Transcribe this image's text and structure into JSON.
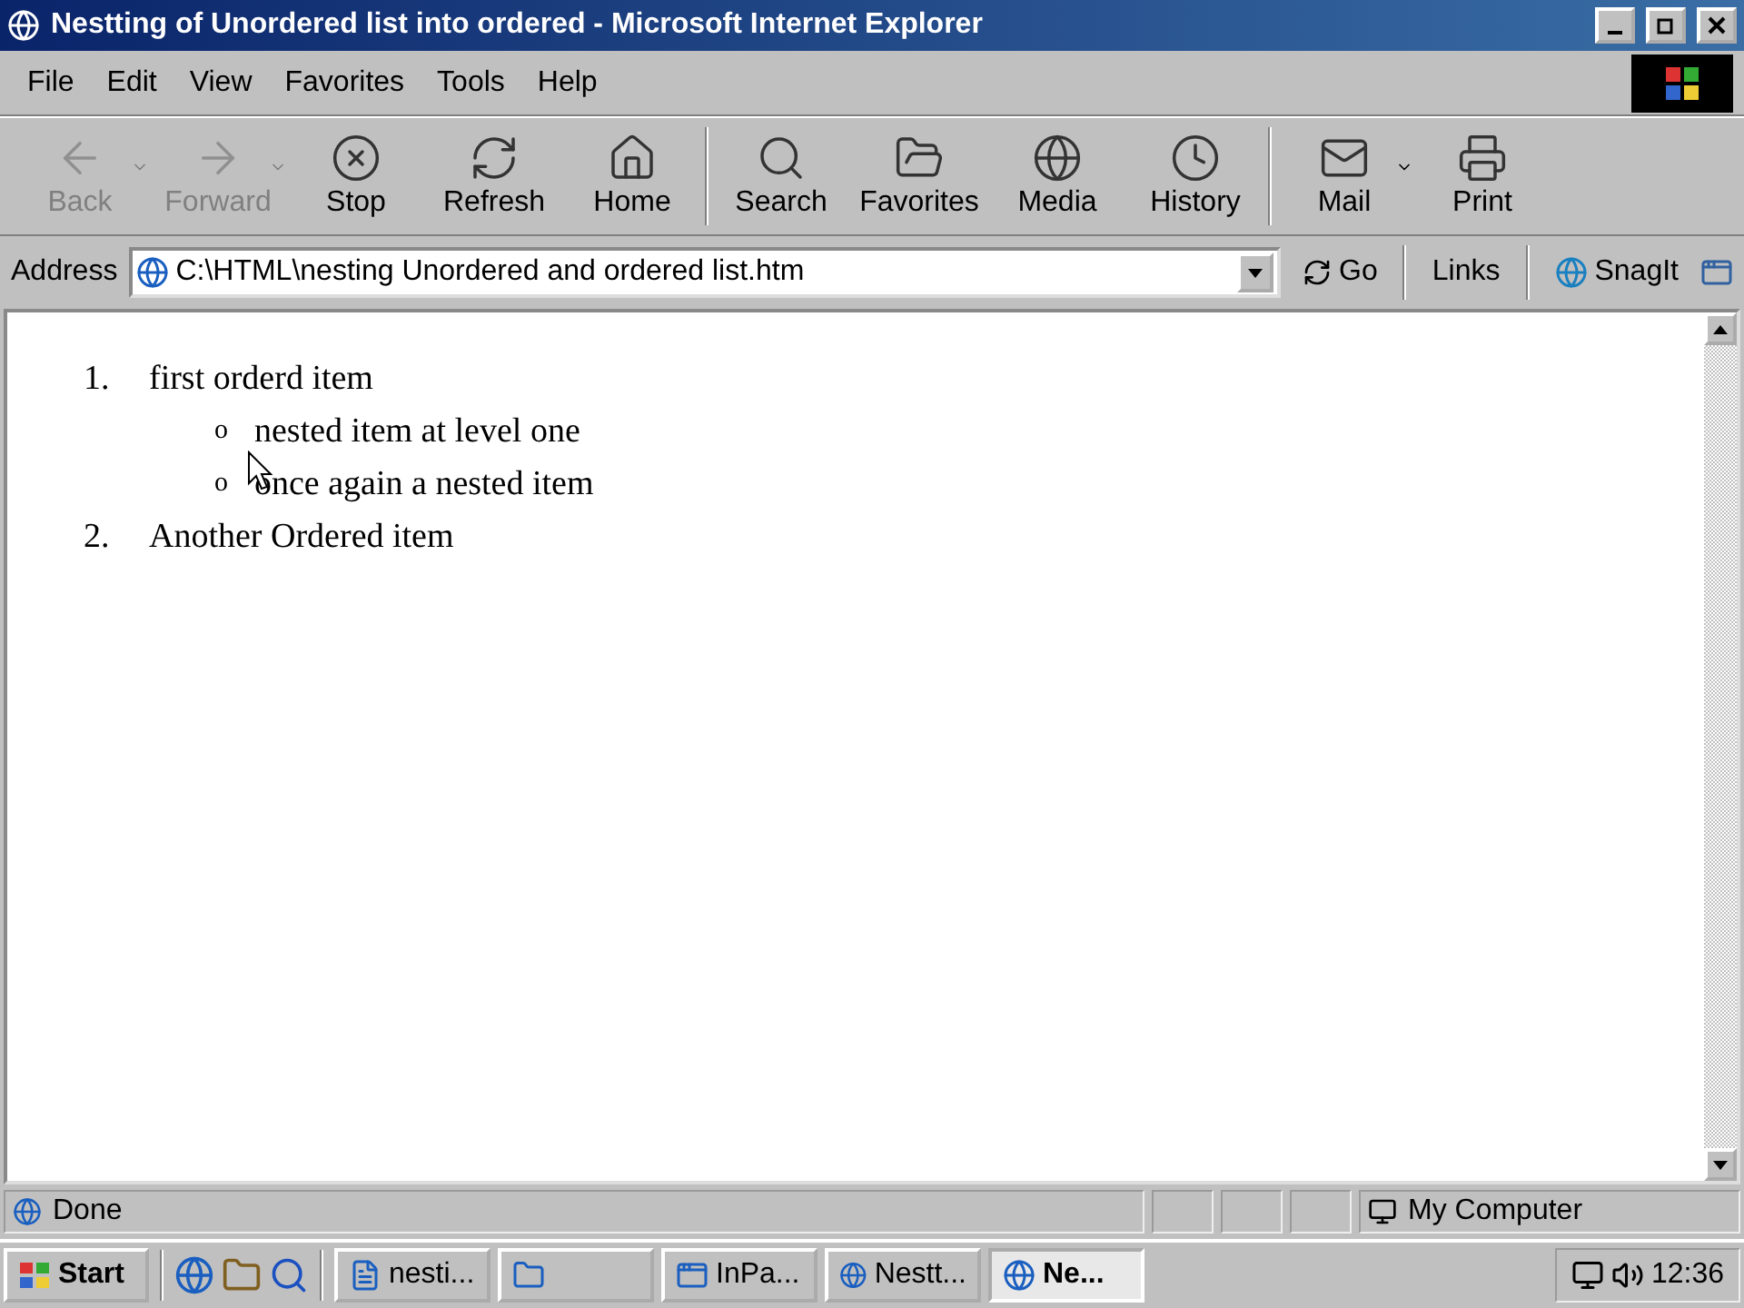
{
  "window": {
    "title": "Nestting of Unordered list into ordered - Microsoft Internet Explorer"
  },
  "menu": [
    "File",
    "Edit",
    "View",
    "Favorites",
    "Tools",
    "Help"
  ],
  "toolbar": [
    {
      "label": "Back",
      "kind": "back",
      "disabled": true,
      "dropdown": true
    },
    {
      "label": "Forward",
      "kind": "forward",
      "disabled": true,
      "dropdown": true
    },
    {
      "label": "Stop",
      "kind": "stop",
      "disabled": false,
      "dropdown": false
    },
    {
      "label": "Refresh",
      "kind": "refresh",
      "disabled": false,
      "dropdown": false
    },
    {
      "label": "Home",
      "kind": "home",
      "disabled": false,
      "dropdown": false
    },
    {
      "label": "Search",
      "kind": "search",
      "disabled": false,
      "dropdown": false
    },
    {
      "label": "Favorites",
      "kind": "favorites",
      "disabled": false,
      "dropdown": false
    },
    {
      "label": "Media",
      "kind": "media",
      "disabled": false,
      "dropdown": false
    },
    {
      "label": "History",
      "kind": "history",
      "disabled": false,
      "dropdown": false
    },
    {
      "label": "Mail",
      "kind": "mail",
      "disabled": false,
      "dropdown": true
    },
    {
      "label": "Print",
      "kind": "print",
      "disabled": false,
      "dropdown": false
    }
  ],
  "address_bar": {
    "label": "Address",
    "value": "C:\\HTML\\nesting Unordered and ordered list.htm",
    "go": "Go",
    "links": "Links",
    "snagit": "SnagIt"
  },
  "page": {
    "items": [
      {
        "number": "1.",
        "text": "first orderd item",
        "children": [
          {
            "bullet": "o",
            "text": "nested item at level one"
          },
          {
            "bullet": "o",
            "text": "once again a nested item"
          }
        ]
      },
      {
        "number": "2.",
        "text": "Another Ordered item"
      }
    ]
  },
  "status_bar": {
    "text": "Done",
    "zone": "My Computer"
  },
  "taskbar": {
    "start": "Start",
    "tasks": [
      {
        "label": "nesti...",
        "kind": "doc",
        "selected": false
      },
      {
        "kind": "folder",
        "selected": false
      },
      {
        "label": "InPa...",
        "kind": "app",
        "selected": false
      },
      {
        "label": "Nestt...",
        "kind": "ie",
        "selected": false
      },
      {
        "label": "Ne...",
        "kind": "ie",
        "selected": true
      }
    ],
    "clock": "12:36"
  }
}
